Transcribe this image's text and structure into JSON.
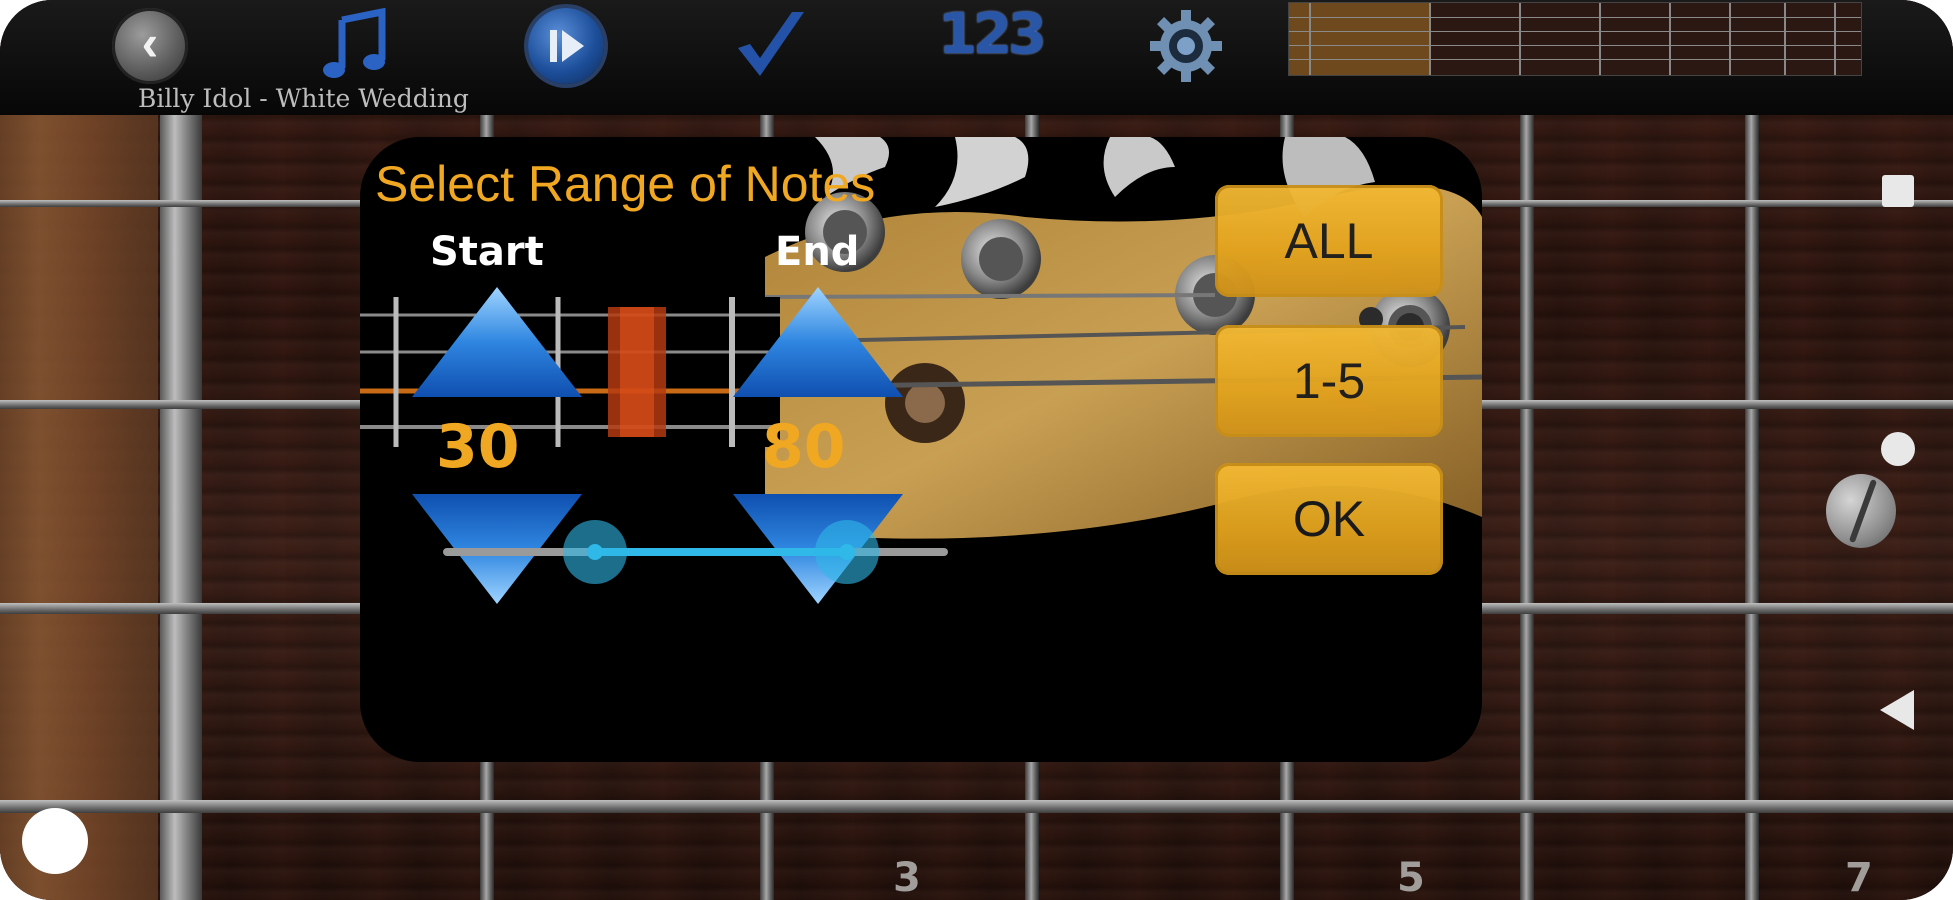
{
  "toolbar": {
    "song_title": "Billy Idol - White Wedding",
    "number_icon_text": "123",
    "icons": [
      "back-icon",
      "music-note-icon",
      "play-icon",
      "check-icon",
      "numbers-icon",
      "gear-icon"
    ]
  },
  "dialog": {
    "title": "Select Range of Notes",
    "start_label": "Start",
    "end_label": "End",
    "start_value": "30",
    "end_value": "80",
    "buttons": {
      "all": "ALL",
      "one_to_five": "1-5",
      "ok": "OK"
    },
    "range_slider": {
      "min": 0,
      "max": 100,
      "start": 30,
      "end": 80
    }
  },
  "fretboard": {
    "fret_numbers": [
      "3",
      "5",
      "7"
    ]
  },
  "colors": {
    "accent": "#f0a722",
    "button_fill": "#e8a825",
    "slider_active": "#2fb8e8",
    "arrow_blue": "#1e6fd6"
  }
}
